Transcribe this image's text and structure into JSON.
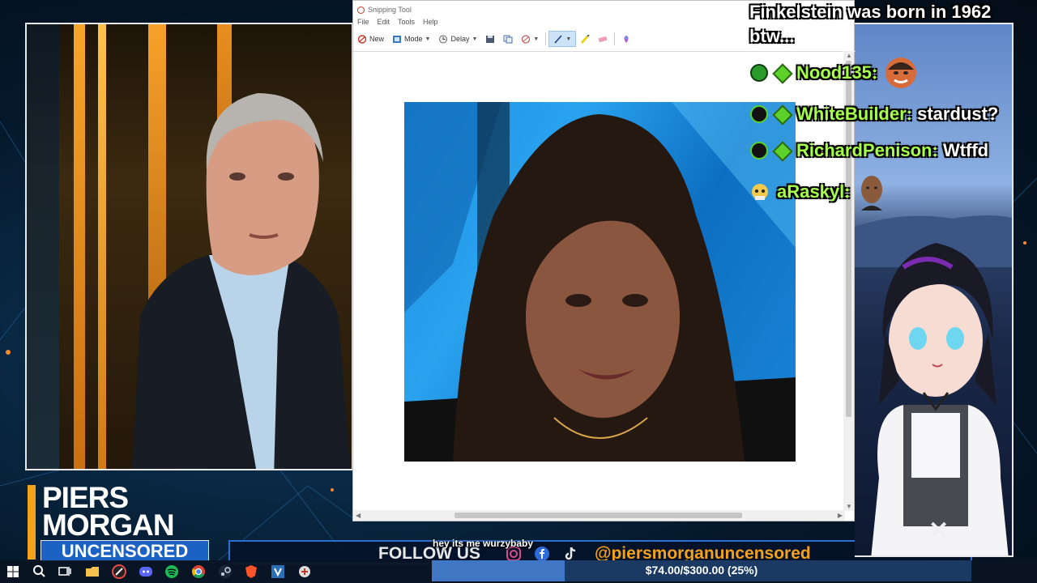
{
  "snipping_tool": {
    "title": "Snipping Tool",
    "menu": [
      "File",
      "Edit",
      "Tools",
      "Help"
    ],
    "toolbar": {
      "new_label": "New",
      "mode_label": "Mode",
      "delay_label": "Delay"
    }
  },
  "chat": {
    "top_message": "Finkelstein was born in 1962 btw...",
    "top_line1": "Finkelstein was born in 1962",
    "top_line2": "btw...",
    "messages": [
      {
        "user": "Nood135:",
        "text": ""
      },
      {
        "user": "WhiteBuilder:",
        "text": "stardust?"
      },
      {
        "user": "RichardPenison:",
        "text": "Wtffd"
      },
      {
        "user": "aRaskyl:",
        "text": ""
      }
    ]
  },
  "show": {
    "logo_line1": "PIERS",
    "logo_line2": "MORGAN",
    "logo_line3": "UNCENSORED",
    "follow_label": "FOLLOW US",
    "handle": "@piersmorganuncensored",
    "subtitle": "hey its me wurzybaby"
  },
  "donation": {
    "text": "$74.00/$300.00 (25%)",
    "current": 74.0,
    "goal": 300.0,
    "percent": 25
  },
  "taskbar": {
    "icons": [
      "windows-start-icon",
      "search-icon",
      "task-view-icon",
      "file-explorer-icon",
      "app-icon",
      "discord-icon",
      "spotify-icon",
      "chrome-icon",
      "steam-icon",
      "brave-icon",
      "vscode-icon",
      "app-icon"
    ]
  },
  "colors": {
    "accent_orange": "#f4a11b",
    "brand_blue": "#1b62c4",
    "chat_name_green": "#a6ff4a"
  }
}
